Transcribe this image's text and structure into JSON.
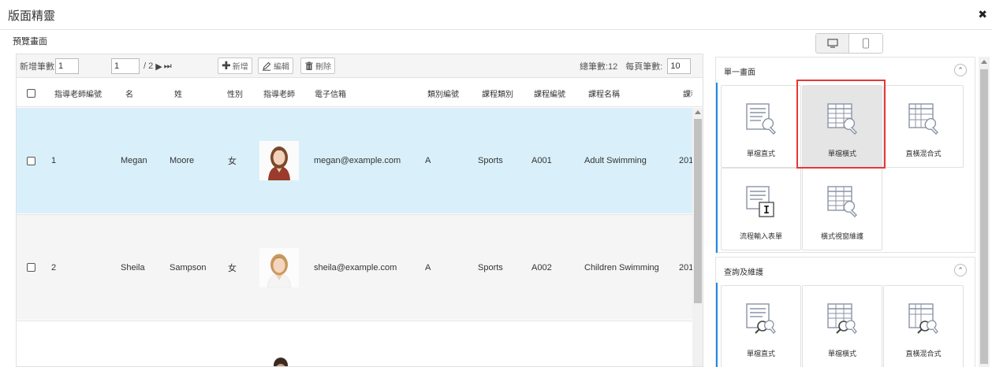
{
  "window": {
    "title": "版面精靈",
    "close_glyph": "✖"
  },
  "preview_label": "預覽畫面",
  "device_toggle": {
    "desktop_icon": "desktop-icon",
    "mobile_icon": "mobile-icon",
    "active": "desktop"
  },
  "toolbar": {
    "new_count_label": "新增筆數",
    "new_count_value": "1",
    "page_value": "1",
    "page_total": "/ 2",
    "next_glyph": "▶",
    "last_glyph": "⏭",
    "add_label": "新增",
    "edit_label": "編輯",
    "delete_label": "刪除",
    "total_label": "總筆數:12",
    "per_page_label": "每頁筆數:",
    "per_page_value": "10"
  },
  "columns": [
    "指導老師編號",
    "名",
    "姓",
    "性別",
    "指導老師",
    "電子信箱",
    "類別編號",
    "課程類別",
    "課程編號",
    "課程名稱",
    "課程起"
  ],
  "rows": [
    {
      "id": "1",
      "first": "Megan",
      "last": "Moore",
      "gender": "女",
      "email": "megan@example.com",
      "cat_id": "A",
      "category": "Sports",
      "course_id": "A001",
      "course_name": "Adult Swimming",
      "start": "201"
    },
    {
      "id": "2",
      "first": "Sheila",
      "last": "Sampson",
      "gender": "女",
      "email": "sheila@example.com",
      "cat_id": "A",
      "category": "Sports",
      "course_id": "A002",
      "course_name": "Children Swimming",
      "start": "201"
    }
  ],
  "sections": [
    {
      "title": "單一畫面",
      "collapse_glyph": "⌃",
      "tiles": [
        {
          "label": "單檔直式",
          "icon": "single-vertical-icon",
          "selected": false
        },
        {
          "label": "單檔橫式",
          "icon": "single-horizontal-icon",
          "selected": true
        },
        {
          "label": "直橫混合式",
          "icon": "mixed-layout-icon",
          "selected": false
        },
        {
          "label": "流程輸入表單",
          "icon": "flow-input-form-icon",
          "selected": false
        },
        {
          "label": "橫式視窗維護",
          "icon": "horizontal-window-icon",
          "selected": false
        }
      ]
    },
    {
      "title": "查詢及維護",
      "collapse_glyph": "⌃",
      "tiles": [
        {
          "label": "單檔直式",
          "icon": "query-vertical-icon",
          "selected": false
        },
        {
          "label": "單檔橫式",
          "icon": "query-horizontal-icon",
          "selected": false
        },
        {
          "label": "直橫混合式",
          "icon": "query-mixed-icon",
          "selected": false
        }
      ]
    }
  ],
  "colors": {
    "row_highlight": "#d9f0fa",
    "accent_blue": "#1e88e5",
    "selection_red": "#e53935",
    "icon_gray": "#8a93a6"
  }
}
